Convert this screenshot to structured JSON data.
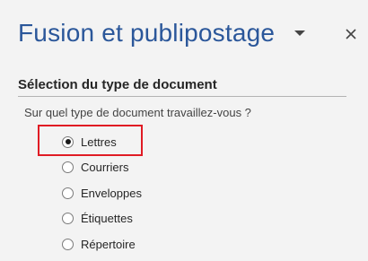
{
  "pane": {
    "title": "Fusion et publipostage",
    "dropdown_icon": "chevron-down-icon",
    "close_icon": "close-icon"
  },
  "section": {
    "heading": "Sélection du type de document",
    "question": "Sur quel type de document travaillez-vous ?"
  },
  "options": [
    {
      "label": "Lettres",
      "checked": true
    },
    {
      "label": "Courriers",
      "checked": false
    },
    {
      "label": "Enveloppes",
      "checked": false
    },
    {
      "label": "Étiquettes",
      "checked": false
    },
    {
      "label": "Répertoire",
      "checked": false
    }
  ],
  "colors": {
    "title": "#2b579a",
    "highlight": "#e01b24",
    "background": "#f3f3f3"
  }
}
